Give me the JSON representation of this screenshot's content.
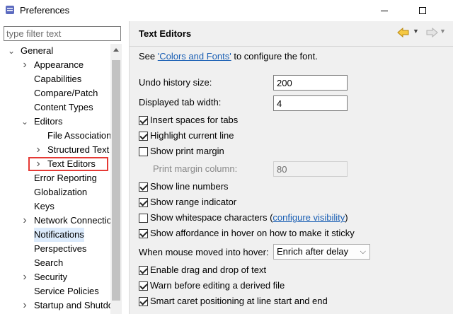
{
  "window": {
    "title": "Preferences"
  },
  "filter": {
    "placeholder": "type filter text"
  },
  "tree": {
    "items": [
      {
        "label": "General",
        "indent": 0,
        "expander": "v"
      },
      {
        "label": "Appearance",
        "indent": 1,
        "expander": ">"
      },
      {
        "label": "Capabilities",
        "indent": 1,
        "expander": ""
      },
      {
        "label": "Compare/Patch",
        "indent": 1,
        "expander": ""
      },
      {
        "label": "Content Types",
        "indent": 1,
        "expander": ""
      },
      {
        "label": "Editors",
        "indent": 1,
        "expander": "v"
      },
      {
        "label": "File Associations",
        "indent": 2,
        "expander": ""
      },
      {
        "label": "Structured Text",
        "indent": 2,
        "expander": ">"
      },
      {
        "label": "Text Editors",
        "indent": 2,
        "expander": ">",
        "selected": true
      },
      {
        "label": "Error Reporting",
        "indent": 1,
        "expander": ""
      },
      {
        "label": "Globalization",
        "indent": 1,
        "expander": ""
      },
      {
        "label": "Keys",
        "indent": 1,
        "expander": ""
      },
      {
        "label": "Network Connections",
        "indent": 1,
        "expander": ">"
      },
      {
        "label": "Notifications",
        "indent": 1,
        "expander": "",
        "highlighted": true
      },
      {
        "label": "Perspectives",
        "indent": 1,
        "expander": ""
      },
      {
        "label": "Search",
        "indent": 1,
        "expander": ""
      },
      {
        "label": "Security",
        "indent": 1,
        "expander": ">"
      },
      {
        "label": "Service Policies",
        "indent": 1,
        "expander": ""
      },
      {
        "label": "Startup and Shutdown",
        "indent": 1,
        "expander": ">"
      }
    ]
  },
  "page": {
    "title": "Text Editors",
    "see_prefix": "See ",
    "see_link": "'Colors and Fonts'",
    "see_suffix": " to configure the font.",
    "undo_label": "Undo history size:",
    "undo_value": "200",
    "tab_width_label": "Displayed tab width:",
    "tab_width_value": "4",
    "insert_spaces": "Insert spaces for tabs",
    "highlight_line": "Highlight current line",
    "show_print_margin": "Show print margin",
    "print_margin_label": "Print margin column:",
    "print_margin_value": "80",
    "show_line_numbers": "Show line numbers",
    "show_range": "Show range indicator",
    "show_whitespace": "Show whitespace characters (",
    "configure_visibility": "configure visibility",
    "show_whitespace_close": ")",
    "show_affordance": "Show affordance in hover on how to make it sticky",
    "hover_label": "When mouse moved into hover:",
    "hover_value": "Enrich after delay",
    "drag_drop": "Enable drag and drop of text",
    "warn_derived": "Warn before editing a derived file",
    "smart_caret": "Smart caret positioning at line start and end"
  },
  "checkboxes": {
    "insert_spaces": true,
    "highlight_line": true,
    "show_print_margin": false,
    "show_line_numbers": true,
    "show_range": true,
    "show_whitespace": false,
    "show_affordance": true,
    "drag_drop": true,
    "warn_derived": true,
    "smart_caret": true
  },
  "colors": {
    "selection_outline": "#e53935",
    "link": "#1a5fb4",
    "highlight": "#dcebfc"
  }
}
